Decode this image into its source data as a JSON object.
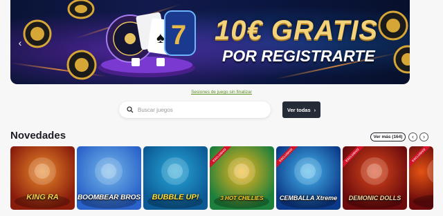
{
  "hero": {
    "line1": "10€ GRATIS",
    "line2": "POR REGISTRARTE"
  },
  "session_link": "Sesiones de juego sin finalizar",
  "search": {
    "placeholder": "Buscar juegos"
  },
  "see_all_label": "Ver todas",
  "section": {
    "title": "Novedades",
    "see_more": "Ver más (164)"
  },
  "games": [
    {
      "name": "KING RA",
      "badge": "",
      "color_a": "#8a1c0c",
      "color_b": "#e9892a"
    },
    {
      "name": "BOOMBEAR BROS",
      "badge": "",
      "color_a": "#2a62c9",
      "color_b": "#74b7ea"
    },
    {
      "name": "BUBBLE UP!",
      "badge": "",
      "color_a": "#0c5a95",
      "color_b": "#27a7d8"
    },
    {
      "name": "3 HOT CHILLIES",
      "badge": "EXCLUSIVO",
      "color_a": "#1c7f3b",
      "color_b": "#f6b51d"
    },
    {
      "name": "CEMBALLA Xtreme",
      "badge": "EXCLUSIVO",
      "color_a": "#0c3a8a",
      "color_b": "#46b7ee"
    },
    {
      "name": "DEMONIC DOLLS",
      "badge": "EXCLUSIVO",
      "color_a": "#6a0a0c",
      "color_b": "#d9481c"
    },
    {
      "name": "",
      "badge": "EXCLUSIVO",
      "color_a": "#6a0a0c",
      "color_b": "#e35312"
    }
  ]
}
